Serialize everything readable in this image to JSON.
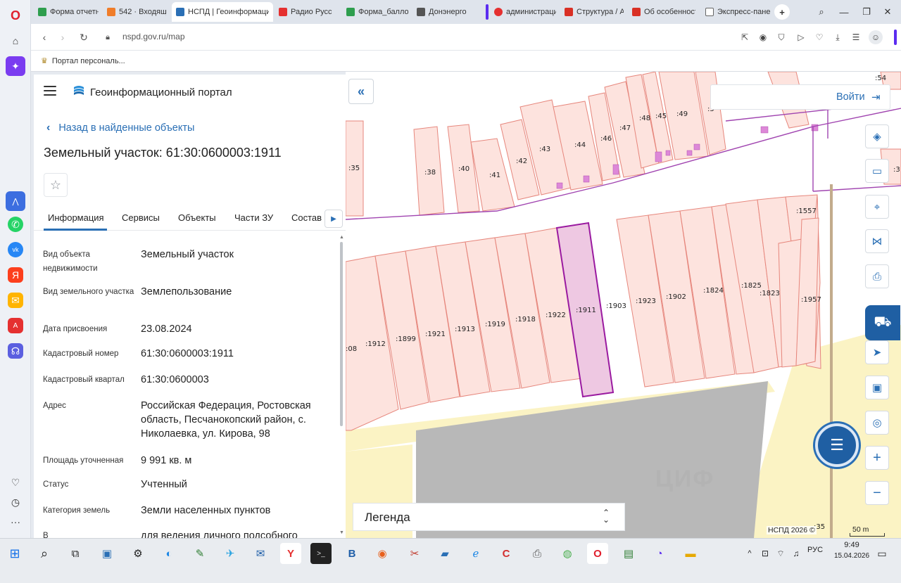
{
  "browser": {
    "tabs": [
      {
        "label": "Форма отчетн",
        "color": "#2e9e4e"
      },
      {
        "label": "542 · Входящи",
        "color": "#f07d2a"
      },
      {
        "label": "НСПД | Геоинформацио",
        "color": "#2a6fb5"
      },
      {
        "label": "Радио Русс",
        "color": "#e53030"
      },
      {
        "label": "Форма_балло",
        "color": "#2e9e4e"
      },
      {
        "label": "Донэнерго",
        "color": "#555555"
      },
      {
        "label": "администраци",
        "color": "#e53030"
      },
      {
        "label": "Структура / Ад",
        "color": "#d93025"
      },
      {
        "label": "Об особенност",
        "color": "#d93025"
      },
      {
        "label": "Экспресс-пане",
        "color": "#666666"
      }
    ],
    "url": "nspd.gov.ru/map",
    "bookmark": "Портал персональ..."
  },
  "panel": {
    "portal_name": "Геоинформационный портал",
    "back_label": "Назад в найденные объекты",
    "title": "Земельный участок: 61:30:0600003:1911",
    "tabs": [
      "Информация",
      "Сервисы",
      "Объекты",
      "Части ЗУ",
      "Состав"
    ],
    "rows": [
      {
        "key": "Вид объекта недвижимости",
        "value": "Земельный участок"
      },
      {
        "key": "Вид земельного участка",
        "value": "Землепользование"
      },
      {
        "key": "Дата присвоения",
        "value": "23.08.2024"
      },
      {
        "key": "Кадастровый номер",
        "value": "61:30:0600003:1911"
      },
      {
        "key": "Кадастровый квартал",
        "value": "61:30:0600003"
      },
      {
        "key": "Адрес",
        "value": "Российская Федерация, Ростовская область, Песчанокопский район, с. Николаевка, ул. Кирова, 98"
      },
      {
        "key": "Площадь уточненная",
        "value": "9 991 кв. м"
      },
      {
        "key": "Статус",
        "value": "Учтенный"
      },
      {
        "key": "Категория земель",
        "value": "Земли населенных пунктов"
      },
      {
        "key": "В",
        "value": "для ведения личного подсобного"
      }
    ]
  },
  "map": {
    "login_label": "Войти",
    "legend_label": "Легенда",
    "copyright": "НСПД 2026 ©",
    "scale": "50 m",
    "watermark": "ЦИФ",
    "top_parcels": [
      ":35",
      ":38",
      ":40",
      ":41",
      ":42",
      ":43",
      ":44",
      ":46",
      ":47",
      ":48",
      ":45",
      ":49",
      ":5",
      ":54",
      ":3"
    ],
    "bottom_parcels": [
      ":08",
      ":1912",
      ":1899",
      ":1921",
      ":1913",
      ":1919",
      ":1918",
      ":1922",
      ":1911",
      ":1903",
      ":1923",
      ":1902",
      ":1824",
      ":1825",
      ":1823",
      ":1957",
      ":1557",
      ":35"
    ],
    "selected_parcel": ":1911",
    "colors": {
      "parcel_fill": "#fde3de",
      "parcel_stroke": "#e6867c",
      "selected_fill": "#eec8e2",
      "selected_stroke": "#9a1aa0",
      "road": "#b0b0b0",
      "yellow": "#fbf3c4"
    }
  },
  "taskbar": {
    "lang": "РУС",
    "time": "9:49",
    "date": "15.04.2026"
  }
}
